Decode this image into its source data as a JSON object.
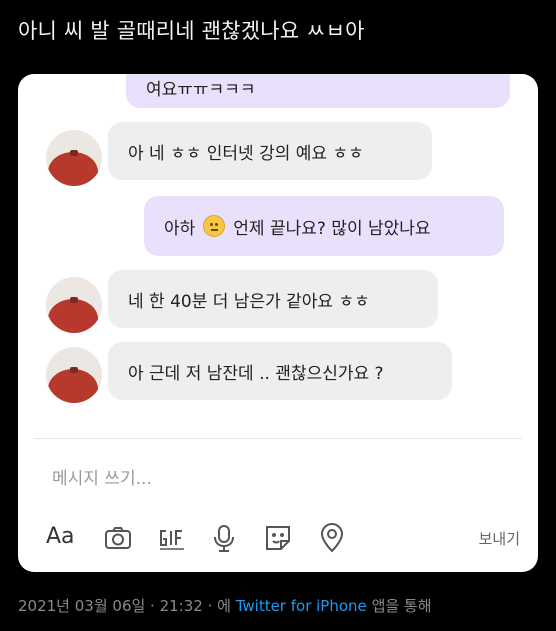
{
  "tweet": {
    "text": "아니 씨 발 골때리네 괜찮겠나요 ㅆㅂ아",
    "date": "2021년 03월 06일 · 21:32 · 에",
    "source": "Twitter for iPhone",
    "source_suffix": "앱을 통해"
  },
  "chat": {
    "partial_top": "여요ㅠㅠㅋㅋㅋ",
    "messages": [
      {
        "side": "in",
        "text": "아 네 ㅎㅎ 인터넷 강의 예요 ㅎㅎ"
      },
      {
        "side": "out",
        "text_before": "아하",
        "text_after": "언제 끝나요? 많이 남았나요",
        "emoji": "grimacing-face"
      },
      {
        "side": "in",
        "text": "네 한 40분 더 남은가 같아요 ㅎㅎ"
      },
      {
        "side": "in",
        "text": "아 근데 저 남잔데 .. 괜찮으신가요 ?"
      }
    ],
    "compose_placeholder": "메시지 쓰기...",
    "toolbar": {
      "text_style": "Aa",
      "icons": [
        "text-style-icon",
        "camera-icon",
        "gif-icon",
        "microphone-icon",
        "sticker-icon",
        "location-icon"
      ],
      "send_label": "보내기"
    }
  }
}
